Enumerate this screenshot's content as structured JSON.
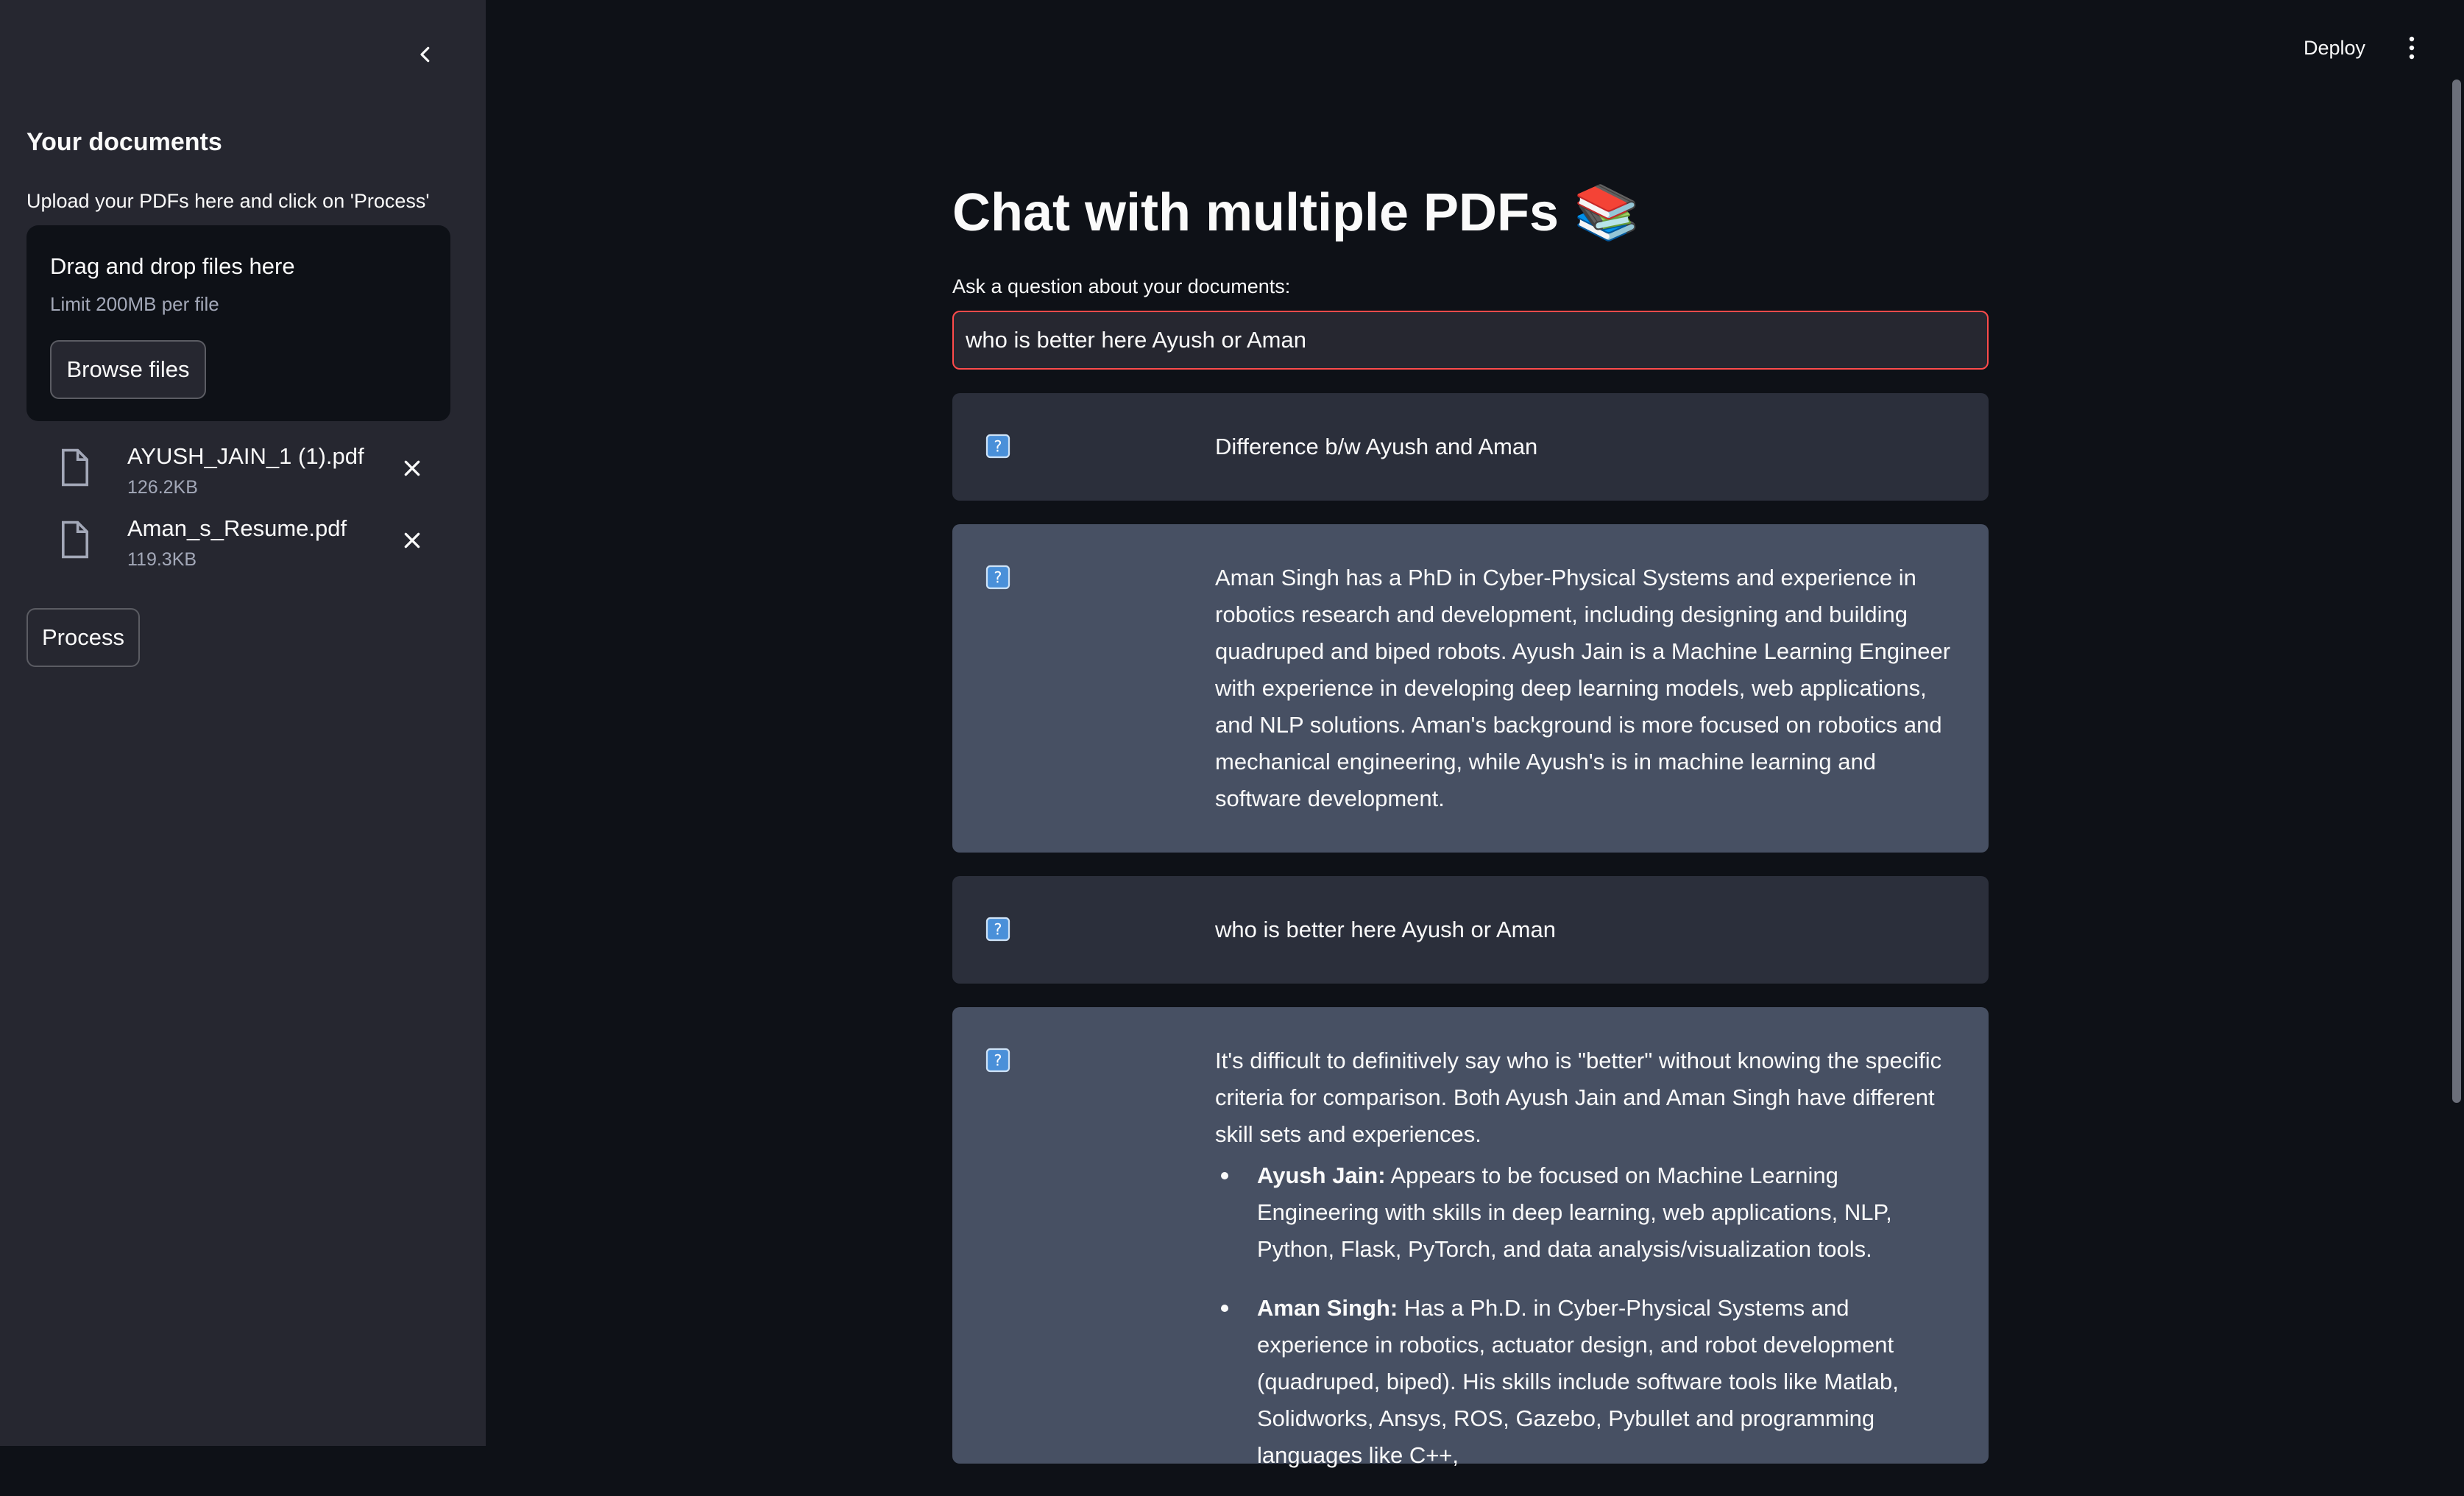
{
  "sidebar": {
    "heading": "Your documents",
    "upload_label": "Upload your PDFs here and click on 'Process'",
    "dropzone": {
      "title": "Drag and drop files here",
      "limit": "Limit 200MB per file",
      "browse_label": "Browse files"
    },
    "files": [
      {
        "name": "AYUSH_JAIN_1 (1).pdf",
        "size": "126.2KB"
      },
      {
        "name": "Aman_s_Resume.pdf",
        "size": "119.3KB"
      }
    ],
    "process_label": "Process"
  },
  "header": {
    "deploy_label": "Deploy"
  },
  "main": {
    "title": "Chat with multiple PDFs 📚",
    "question_label": "Ask a question about your documents:",
    "question_value": "who is better here Ayush or Aman",
    "messages": [
      {
        "role": "user",
        "text": "Difference b/w Ayush and Aman"
      },
      {
        "role": "bot",
        "text": "Aman Singh has a PhD in Cyber-Physical Systems and experience in robotics research and development, including designing and building quadruped and biped robots. Ayush Jain is a Machine Learning Engineer with experience in developing deep learning models, web applications, and NLP solutions. Aman's background is more focused on robotics and mechanical engineering, while Ayush's is in machine learning and software development."
      },
      {
        "role": "user",
        "text": "who is better here Ayush or Aman"
      },
      {
        "role": "bot",
        "intro": "It's difficult to definitively say who is \"better\" without knowing the specific criteria for comparison. Both Ayush Jain and Aman Singh have different skill sets and experiences.",
        "bullets": [
          {
            "label": "Ayush Jain:",
            "text": " Appears to be focused on Machine Learning Engineering with skills in deep learning, web applications, NLP, Python, Flask, PyTorch, and data analysis/visualization tools."
          },
          {
            "label": "Aman Singh:",
            "text": " Has a Ph.D. in Cyber-Physical Systems and experience in robotics, actuator design, and robot development (quadruped, biped). His skills include software tools like Matlab, Solidworks, Ansys, ROS, Gazebo, Pybullet and programming languages like C++,"
          }
        ]
      }
    ]
  },
  "icons": {
    "collapse": "chevron-left-icon",
    "file": "file-icon",
    "remove": "close-icon",
    "avatar": "question-icon",
    "menu": "more-vertical-icon"
  },
  "colors": {
    "app_bg": "#0e1117",
    "sidebar_bg": "#262730",
    "user_msg_bg": "#2b2f3b",
    "bot_msg_bg": "#475063",
    "input_border": "#ff4b4b"
  }
}
